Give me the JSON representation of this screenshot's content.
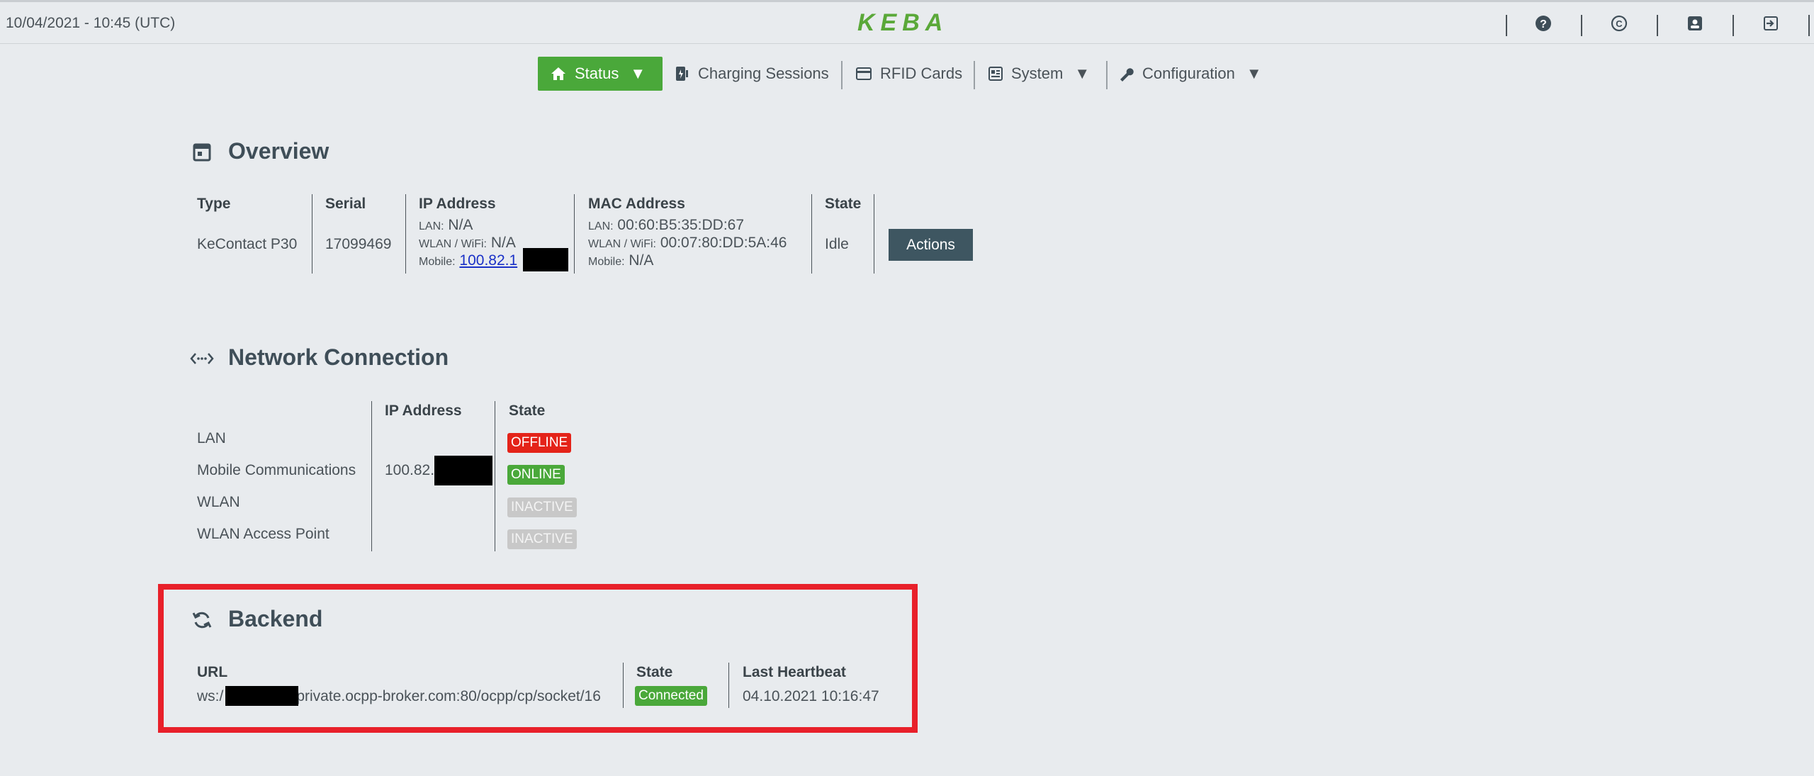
{
  "topbar": {
    "datetime": "10/04/2021 - 10:45 (UTC)",
    "logo": "KEBA",
    "icons": [
      "help-icon",
      "copyright-icon",
      "user-icon",
      "logout-icon"
    ]
  },
  "nav": {
    "items": [
      {
        "label": "Status",
        "icon": "home-icon",
        "caret": "▼",
        "active": true
      },
      {
        "label": "Charging Sessions",
        "icon": "charging-sessions-icon"
      },
      {
        "label": "RFID Cards",
        "icon": "card-icon"
      },
      {
        "label": "System",
        "icon": "system-icon",
        "caret": "▼"
      },
      {
        "label": "Configuration",
        "icon": "wrench-icon",
        "caret": "▼"
      }
    ]
  },
  "overview": {
    "title": "Overview",
    "headers": {
      "type": "Type",
      "serial": "Serial",
      "ip": "IP Address",
      "mac": "MAC Address",
      "state": "State"
    },
    "type": "KeContact P30",
    "serial": "17099469",
    "ip": {
      "lan_label": "LAN:",
      "lan_value": "N/A",
      "wlan_label": "WLAN / WiFi:",
      "wlan_value": "N/A",
      "mobile_label": "Mobile:",
      "mobile_value": "100.82.1"
    },
    "mac": {
      "lan_label": "LAN:",
      "lan_value": "00:60:B5:35:DD:67",
      "wlan_label": "WLAN / WiFi:",
      "wlan_value": "00:07:80:DD:5A:46",
      "mobile_label": "Mobile:",
      "mobile_value": "N/A"
    },
    "state": "Idle",
    "actions_label": "Actions"
  },
  "network": {
    "title": "Network Connection",
    "headers": {
      "ip": "IP Address",
      "state": "State"
    },
    "rows": [
      {
        "name": "LAN",
        "ip": "",
        "state": "OFFLINE",
        "color": "#e42319"
      },
      {
        "name": "Mobile Communications",
        "ip": "100.82.",
        "state": "ONLINE",
        "color": "#4aa83a"
      },
      {
        "name": "WLAN",
        "ip": "",
        "state": "INACTIVE",
        "color": "#c8c8c8"
      },
      {
        "name": "WLAN Access Point",
        "ip": "",
        "state": "INACTIVE",
        "color": "#c8c8c8"
      }
    ]
  },
  "backend": {
    "title": "Backend",
    "headers": {
      "url": "URL",
      "state": "State",
      "heartbeat": "Last Heartbeat"
    },
    "url_prefix": "ws:/",
    "url_suffix": "private.ocpp-broker.com:80/ocpp/cp/socket/16",
    "state": "Connected",
    "heartbeat": "04.10.2021 10:16:47"
  },
  "colors": {
    "accent": "#4aa83a",
    "highlight": "#e8202a",
    "offline": "#e42319",
    "button": "#3e5661"
  }
}
